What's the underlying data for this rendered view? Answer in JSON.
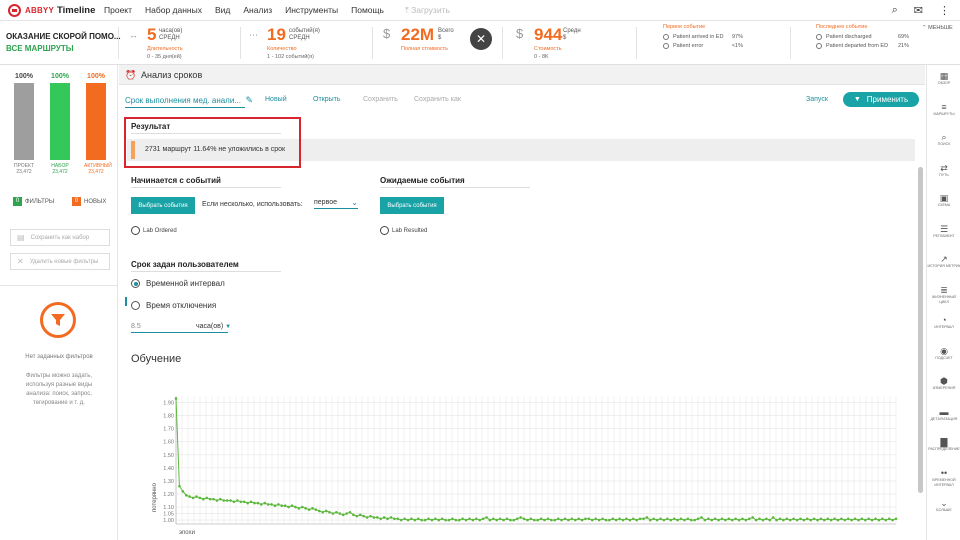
{
  "topbar": {
    "brand": "ABBYY",
    "product": "Timeline",
    "menu": [
      "Проект",
      "Набор данных",
      "Вид",
      "Анализ",
      "Инструменты",
      "Помощь"
    ],
    "upload": "Загрузить",
    "icons": [
      "search-icon",
      "mail-icon",
      "more-vert-icon"
    ]
  },
  "kpi": {
    "route_title": "ОКАЗАНИЕ СКОРОЙ ПОМО...",
    "route_all": "ВСЕ МАРШРУТЫ",
    "duration": {
      "value": "5",
      "unit1": "часа(ов)",
      "unit2": "СРЕДН",
      "label": "Длительность",
      "sub": "0 - 35 дня(ей)"
    },
    "count": {
      "value": "19",
      "unit1": "событий(я)",
      "unit2": "СРЕДН",
      "label": "Количество",
      "sub": "1 - 102 событий(я)"
    },
    "total_cost": {
      "value": "22M",
      "unit1": "Всего",
      "unit2": "$",
      "label": "Полная стоимость",
      "sub": ""
    },
    "cost": {
      "value": "944",
      "unit1": "Средн",
      "unit2": "$",
      "label": "Стоимость",
      "sub": "0 - 8K"
    },
    "first_events": {
      "title": "Первое событие",
      "rows": [
        {
          "name": "Patient arrived in ED",
          "pct": "97%"
        },
        {
          "name": "Patient error",
          "pct": "<1%"
        }
      ]
    },
    "last_events": {
      "title": "Последнее событие",
      "rows": [
        {
          "name": "Patient discharged",
          "pct": "69%"
        },
        {
          "name": "Patient departed from ED",
          "pct": "21%"
        }
      ]
    },
    "less": "МЕНЬШЕ"
  },
  "left": {
    "bars": [
      {
        "pct": "100%",
        "name": "ПРОЕКТ",
        "value": "23,472",
        "color": "#9e9e9e"
      },
      {
        "pct": "100%",
        "name": "НАБОР",
        "value": "23,472",
        "color": "#34c759"
      },
      {
        "pct": "100%",
        "name": "АКТИВНЫЙ",
        "value": "23,472",
        "color": "#f26b21"
      }
    ],
    "filters_count": "0",
    "filters_label": "ФИЛЬТРЫ",
    "new_count": "0",
    "new_label": "НОВЫХ",
    "save_set": "Сохранить как набор",
    "delete_new": "Удалить новые фильтры",
    "no_filters_title": "Нет заданных фильтров",
    "no_filters_text": "Фильтры можно задать, используя разные виды анализа: поиск, запрос, тегирование и т. д."
  },
  "main": {
    "header": "Анализ сроков",
    "tool_name": "Срок выполнения мед. анали...",
    "new": "Новый",
    "open": "Открыть",
    "save": "Сохранить",
    "save_as": "Сохранить как",
    "run": "Запуск",
    "apply": "Применить",
    "result_title": "Результат",
    "result_text": "2731 маршрут 11.64% не уложились в срок",
    "start_title": "Начинается с событий",
    "choose_events": "Выбрать события",
    "multi_label": "Если несколько, использовать:",
    "multi_value": "первое",
    "start_event": "Lab Ordered",
    "expected_title": "Ожидаемые события",
    "choose_events2": "Выбрать события",
    "expected_event": "Lab Resulted",
    "user_title": "Срок задан пользователем",
    "radio1": "Временной интервал",
    "radio2": "Время отключения",
    "num_value": "8.5",
    "num_unit": "часа(ов)",
    "learn_title": "Обучение"
  },
  "chart_data": {
    "type": "line",
    "title": "",
    "xlabel": "эпохи",
    "ylabel": "потерянно",
    "ylim": [
      0.97,
      1.95
    ],
    "yticks": [
      "1.90",
      "1.80",
      "1.70",
      "1.60",
      "1.50",
      "1.40",
      "1.30",
      "1.20",
      "1.10",
      "1.05",
      "1.00"
    ],
    "ytick_values": [
      1.9,
      1.8,
      1.7,
      1.6,
      1.5,
      1.4,
      1.3,
      1.2,
      1.1,
      1.05,
      1.0
    ],
    "color": "#5cb83c",
    "values": [
      1.93,
      1.26,
      1.22,
      1.19,
      1.18,
      1.17,
      1.18,
      1.17,
      1.16,
      1.17,
      1.16,
      1.16,
      1.15,
      1.16,
      1.15,
      1.15,
      1.15,
      1.14,
      1.15,
      1.14,
      1.14,
      1.13,
      1.14,
      1.13,
      1.13,
      1.12,
      1.13,
      1.12,
      1.12,
      1.11,
      1.12,
      1.11,
      1.11,
      1.1,
      1.11,
      1.1,
      1.09,
      1.1,
      1.09,
      1.08,
      1.09,
      1.08,
      1.07,
      1.06,
      1.07,
      1.06,
      1.05,
      1.06,
      1.05,
      1.04,
      1.05,
      1.06,
      1.04,
      1.03,
      1.04,
      1.03,
      1.02,
      1.03,
      1.02,
      1.02,
      1.01,
      1.02,
      1.01,
      1.02,
      1.01,
      1.01,
      1.0,
      1.01,
      1.0,
      1.01,
      1.0,
      1.01,
      1.0,
      1.0,
      1.01,
      1.0,
      1.01,
      1.0,
      1.01,
      1.0,
      1.0,
      1.01,
      1.0,
      1.0,
      1.01,
      1.0,
      1.01,
      1.0,
      1.01,
      1.0,
      1.01,
      1.02,
      1.0,
      1.01,
      1.0,
      1.01,
      1.0,
      1.01,
      1.0,
      1.0,
      1.01,
      1.02,
      1.01,
      1.0,
      1.01,
      1.0,
      1.0,
      1.01,
      1.0,
      1.01,
      1.0,
      1.0,
      1.01,
      1.0,
      1.01,
      1.0,
      1.01,
      1.0,
      1.01,
      1.0,
      1.01,
      1.01,
      1.0,
      1.01,
      1.0,
      1.01,
      1.0,
      1.0,
      1.01,
      1.0,
      1.01,
      1.0,
      1.01,
      1.0,
      1.01,
      1.0,
      1.01,
      1.01,
      1.02,
      1.0,
      1.01,
      1.0,
      1.01,
      1.0,
      1.01,
      1.0,
      1.01,
      1.0,
      1.01,
      1.0,
      1.01,
      1.0,
      1.0,
      1.01,
      1.02,
      1.0,
      1.01,
      1.0,
      1.01,
      1.0,
      1.01,
      1.0,
      1.01,
      1.0,
      1.01,
      1.0,
      1.01,
      1.0,
      1.01,
      1.02,
      1.0,
      1.01,
      1.0,
      1.01,
      1.0,
      1.02,
      1.0,
      1.01,
      1.0,
      1.01,
      1.0,
      1.01,
      1.0,
      1.01,
      1.0,
      1.01,
      1.0,
      1.01,
      1.0,
      1.01,
      1.0,
      1.01,
      1.0,
      1.01,
      1.0,
      1.01,
      1.0,
      1.01,
      1.0,
      1.01,
      1.0,
      1.01,
      1.0,
      1.01,
      1.0,
      1.01,
      1.0,
      1.01,
      1.0,
      1.01,
      1.0,
      1.01
    ]
  },
  "rightrail": [
    {
      "label": "ОБЗОР",
      "icon": "dashboard-icon"
    },
    {
      "label": "МАРШРУТЫ",
      "icon": "routes-icon"
    },
    {
      "label": "ПОИСК",
      "icon": "search-icon"
    },
    {
      "label": "ПУТЬ",
      "icon": "path-icon"
    },
    {
      "label": "СХЕМА",
      "icon": "scheme-icon"
    },
    {
      "label": "РЕГЛАМЕНТ",
      "icon": "rules-icon"
    },
    {
      "label": "ИСТОРИЯ МЕТРИК",
      "icon": "metrics-icon"
    },
    {
      "label": "ЖИЗНЕННЫЙ ЦИКЛ",
      "icon": "lifecycle-icon"
    },
    {
      "label": "ИНТЕРВАЛ",
      "icon": "interval-icon"
    },
    {
      "label": "ПОДСЧЕТ",
      "icon": "count-icon"
    },
    {
      "label": "ИЗМЕРЕНИЯ",
      "icon": "measure-icon"
    },
    {
      "label": "ДЕТАЛИЗАЦИЯ",
      "icon": "detail-icon"
    },
    {
      "label": "РАСПРЕДЕЛЕНИЕ",
      "icon": "distribution-icon"
    },
    {
      "label": "ВРЕМЕННОЙ ИНТЕРВАЛ",
      "icon": "time-interval-icon"
    },
    {
      "label": "БОЛЬШЕ",
      "icon": "more-icon"
    }
  ]
}
